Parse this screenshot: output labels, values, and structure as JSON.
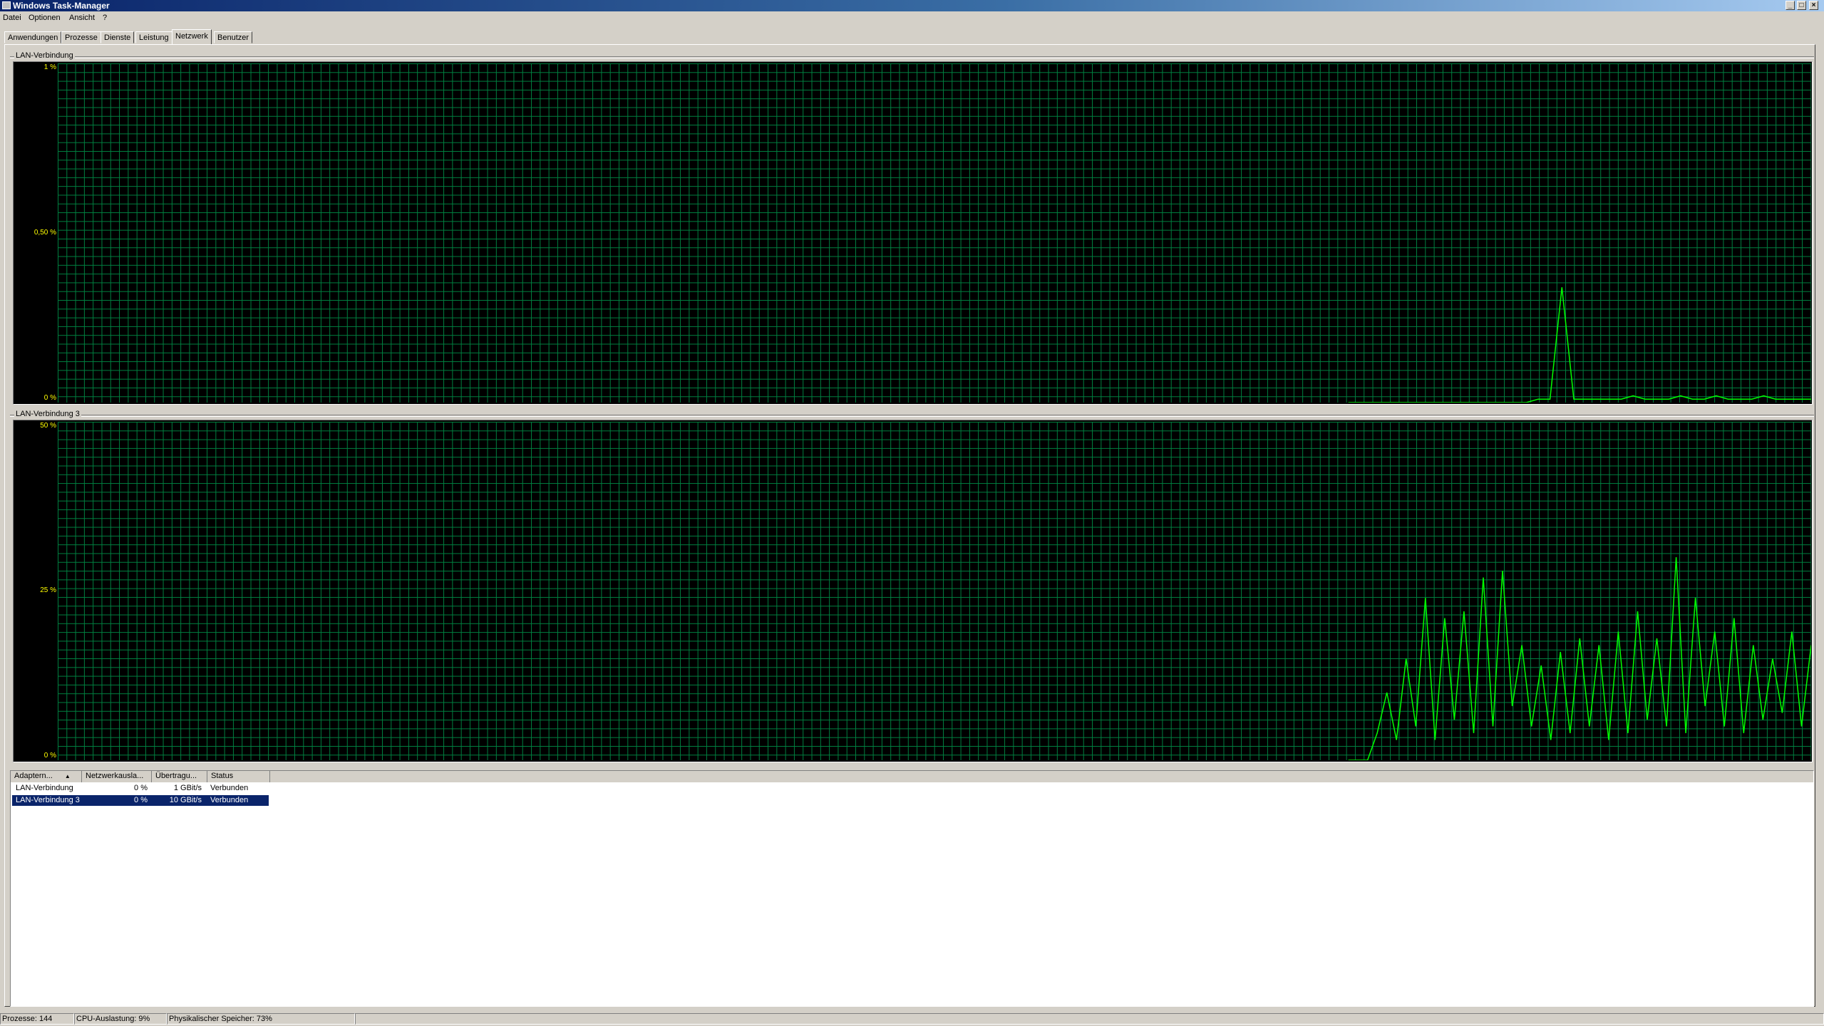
{
  "window": {
    "title": "Windows Task-Manager",
    "buttons": [
      "minimize-icon",
      "maximize-icon",
      "close-icon"
    ]
  },
  "menu": [
    "Datei",
    "Optionen",
    "Ansicht",
    "?"
  ],
  "tabs": [
    {
      "label": "Anwendungen",
      "active": false
    },
    {
      "label": "Prozesse",
      "active": false
    },
    {
      "label": "Dienste",
      "active": false
    },
    {
      "label": "Leistung",
      "active": false
    },
    {
      "label": "Netzwerk",
      "active": true
    },
    {
      "label": "Benutzer",
      "active": false
    }
  ],
  "graphs": [
    {
      "title": "LAN-Verbindung",
      "scale": {
        "top": "1 %",
        "mid": "0,50 %",
        "bottom": "0 %"
      }
    },
    {
      "title": "LAN-Verbindung 3",
      "scale": {
        "top": "50 %",
        "mid": "25 %",
        "bottom": "0 %"
      }
    }
  ],
  "chart_data": [
    {
      "type": "line",
      "title": "LAN-Verbindung",
      "ylim": [
        0,
        1
      ],
      "yunit": "%",
      "grid": true,
      "series": [
        {
          "values": [
            0,
            0,
            0,
            0,
            0,
            0,
            0,
            0,
            0,
            0,
            0,
            0,
            0,
            0,
            0,
            0,
            0,
            0,
            0,
            0,
            0,
            0,
            0,
            0,
            0,
            0,
            0,
            0,
            0,
            0,
            0,
            0,
            0,
            0,
            0,
            0,
            0,
            0,
            0,
            0,
            0,
            0,
            0,
            0,
            0,
            0,
            0,
            0,
            0,
            0,
            0,
            0,
            0,
            0,
            0,
            0,
            0,
            0,
            0,
            0,
            0,
            0,
            0,
            0,
            0,
            0,
            0,
            0,
            0,
            0,
            0,
            0,
            0,
            0,
            0,
            0,
            0.01,
            0.01,
            0.34,
            0.01,
            0.01,
            0.01,
            0.01,
            0.01,
            0.02,
            0.01,
            0.01,
            0.01,
            0.02,
            0.01,
            0.01,
            0.02,
            0.01,
            0.01,
            0.01,
            0.02,
            0.01,
            0.01,
            0.01,
            0.01
          ]
        }
      ]
    },
    {
      "type": "line",
      "title": "LAN-Verbindung 3",
      "ylim": [
        0,
        50
      ],
      "yunit": "%",
      "grid": true,
      "series": [
        {
          "values": [
            0,
            0,
            0,
            0,
            0,
            0,
            0,
            0,
            0,
            0,
            0,
            0,
            0,
            0,
            0,
            0,
            0,
            0,
            0,
            0,
            0,
            0,
            0,
            0,
            0,
            0,
            0,
            0,
            0,
            0,
            0,
            0,
            0,
            0,
            0,
            0,
            0,
            0,
            0,
            0,
            0,
            0,
            0,
            0,
            0,
            0,
            0,
            0,
            0,
            0,
            0,
            0,
            0,
            0,
            0,
            0,
            0,
            0,
            0,
            0,
            0,
            0,
            0,
            0,
            0,
            0,
            0,
            0,
            0,
            0,
            0,
            0,
            0,
            0,
            0,
            0,
            4,
            10,
            3,
            15,
            5,
            24,
            3,
            21,
            6,
            22,
            4,
            27,
            5,
            28,
            8,
            17,
            5,
            14,
            3,
            16,
            4,
            18,
            5,
            17,
            3,
            19,
            4,
            22,
            6,
            18,
            5,
            30,
            4,
            24,
            8,
            19,
            5,
            21,
            4,
            17,
            6,
            15,
            7,
            19,
            5,
            17
          ]
        }
      ]
    }
  ],
  "adapter_table": {
    "columns": [
      "Adaptern...",
      "Netzwerkausla...",
      "Übertragu...",
      "Status"
    ],
    "sort_icon": "sort-ascending-icon",
    "rows": [
      {
        "name": "LAN-Verbindung",
        "usage": "0 %",
        "speed": "1 GBit/s",
        "status": "Verbunden",
        "selected": false
      },
      {
        "name": "LAN-Verbindung 3",
        "usage": "0 %",
        "speed": "10 GBit/s",
        "status": "Verbunden",
        "selected": true
      }
    ]
  },
  "status_bar": {
    "processes": "Prozesse: 144",
    "cpu": "CPU-Auslastung: 9%",
    "memory": "Physikalischer Speicher: 73%"
  },
  "colors": {
    "titlebar_start": "#0a246a",
    "titlebar_end": "#a6caf0",
    "grid": "#008040",
    "trace": "#00ff00",
    "scale_label": "#ffff00",
    "selection": "#0a246a"
  }
}
